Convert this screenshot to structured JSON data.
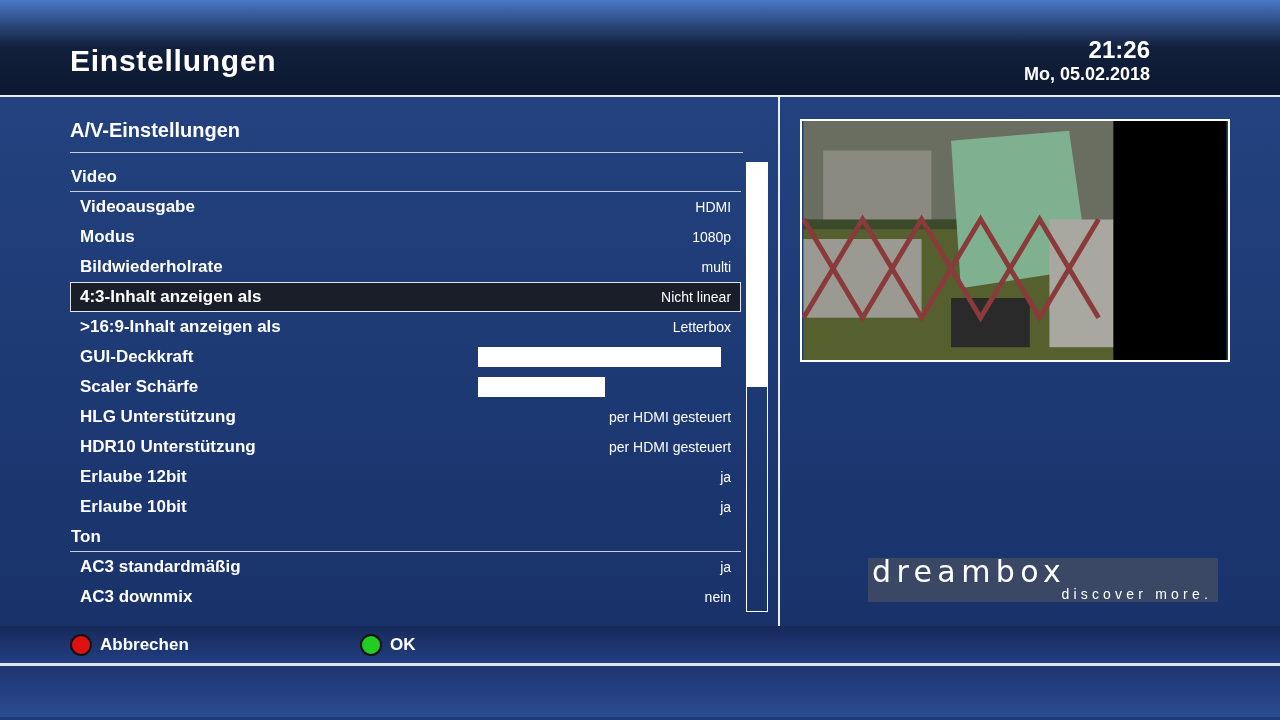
{
  "header": {
    "title": "Einstellungen",
    "time": "21:26",
    "date": "Mo, 05.02.2018"
  },
  "screen_title": "A/V-Einstellungen",
  "items": [
    {
      "kind": "section",
      "label": "Video"
    },
    {
      "kind": "choice",
      "label": "Videoausgabe",
      "value": "HDMI",
      "selected": false
    },
    {
      "kind": "choice",
      "label": "Modus",
      "value": "1080p",
      "selected": false
    },
    {
      "kind": "choice",
      "label": "Bildwiederholrate",
      "value": "multi",
      "selected": false
    },
    {
      "kind": "choice",
      "label": "4:3-Inhalt anzeigen als",
      "value": "Nicht linear",
      "selected": true
    },
    {
      "kind": "choice",
      "label": ">16:9-Inhalt anzeigen als",
      "value": "Letterbox",
      "selected": false
    },
    {
      "kind": "slider",
      "label": "GUI-Deckkraft",
      "level": 0.96,
      "selected": false
    },
    {
      "kind": "slider",
      "label": "Scaler Schärfe",
      "level": 0.5,
      "selected": false
    },
    {
      "kind": "choice",
      "label": "HLG Unterstützung",
      "value": "per HDMI gesteuert",
      "selected": false
    },
    {
      "kind": "choice",
      "label": "HDR10 Unterstützung",
      "value": "per HDMI gesteuert",
      "selected": false
    },
    {
      "kind": "choice",
      "label": "Erlaube 12bit",
      "value": "ja",
      "selected": false
    },
    {
      "kind": "choice",
      "label": "Erlaube 10bit",
      "value": "ja",
      "selected": false
    },
    {
      "kind": "section",
      "label": "Ton"
    },
    {
      "kind": "choice",
      "label": "AC3 standardmäßig",
      "value": "ja",
      "selected": false
    },
    {
      "kind": "choice",
      "label": "AC3 downmix",
      "value": "nein",
      "selected": false
    }
  ],
  "logo": {
    "wordmark": "dreambox",
    "slogan": "discover more."
  },
  "buttons": [
    {
      "label": "Abbrechen",
      "color": "#dd1111"
    },
    {
      "label": "OK",
      "color": "#22cc22"
    }
  ]
}
